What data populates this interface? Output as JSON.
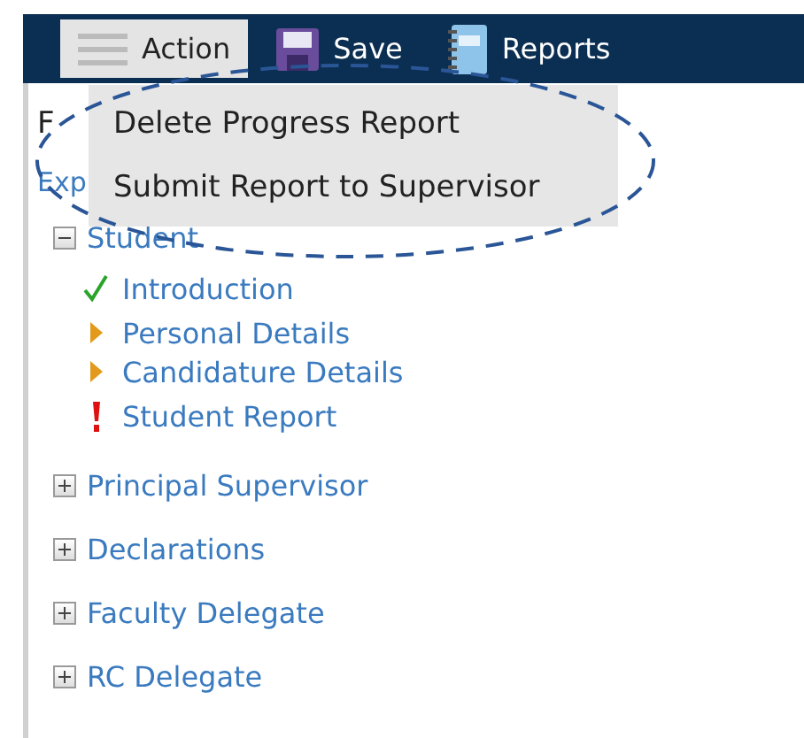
{
  "toolbar": {
    "buttons": [
      {
        "label": "Action",
        "selected": true
      },
      {
        "label": "Save",
        "selected": false
      },
      {
        "label": "Reports",
        "selected": false
      }
    ]
  },
  "action_menu": {
    "open": true,
    "items": [
      "Delete Progress Report",
      "Submit Report to Supervisor"
    ]
  },
  "heading": "F",
  "expand_link": "Exp",
  "tree": [
    {
      "label": "Student",
      "expanded": true,
      "children": [
        {
          "label": "Introduction",
          "kind": "complete"
        },
        {
          "label": "Personal Details",
          "kind": "in_progress"
        },
        {
          "label": "Candidature Details",
          "kind": "in_progress"
        },
        {
          "label": "Student Report",
          "kind": "error"
        }
      ]
    },
    {
      "label": "Principal Supervisor",
      "expanded": false
    },
    {
      "label": "Declarations",
      "expanded": false
    },
    {
      "label": "Faculty Delegate",
      "expanded": false
    },
    {
      "label": "RC Delegate",
      "expanded": false
    }
  ],
  "annotation": {
    "kind": "dashed-ellipse"
  }
}
